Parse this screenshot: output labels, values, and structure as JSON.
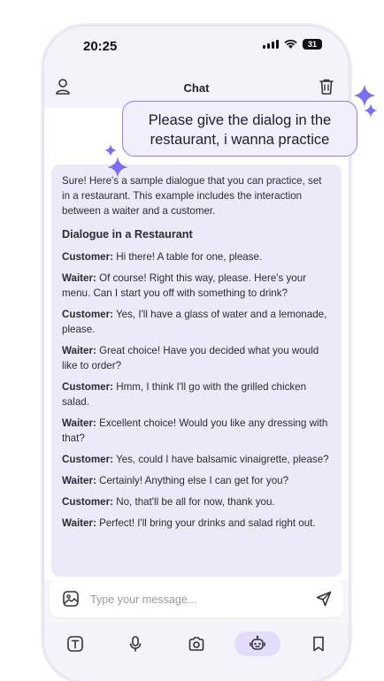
{
  "status_bar": {
    "time": "20:25",
    "battery": "31"
  },
  "header": {
    "title": "Chat"
  },
  "user_message": "Please give the dialog in the restaurant, i wanna practice",
  "assistant_message": {
    "intro": "Sure! Here's a sample dialogue that you can practice, set in a restaurant. This example includes the interaction between a waiter and a customer.",
    "heading": "Dialogue in a Restaurant",
    "lines": [
      {
        "speaker": "Customer:",
        "text": " Hi there! A table for one, please."
      },
      {
        "speaker": "Waiter:",
        "text": " Of course! Right this way, please. Here's your menu. Can I start you off with something to drink?"
      },
      {
        "speaker": "Customer:",
        "text": " Yes, I'll have a glass of water and a lemonade, please."
      },
      {
        "speaker": "Waiter:",
        "text": " Great choice! Have you decided what you would like to order?"
      },
      {
        "speaker": "Customer:",
        "text": " Hmm, I think I'll go with the grilled chicken salad."
      },
      {
        "speaker": "Waiter:",
        "text": " Excellent choice! Would you like any dressing with that?"
      },
      {
        "speaker": "Customer:",
        "text": " Yes, could I have balsamic vinaigrette, please?"
      },
      {
        "speaker": "Waiter:",
        "text": " Certainly! Anything else I can get for you?"
      },
      {
        "speaker": "Customer:",
        "text": " No, that'll be all for now, thank you."
      },
      {
        "speaker": "Waiter:",
        "text": " Perfect! I'll bring your drinks and salad right out."
      }
    ]
  },
  "input": {
    "placeholder": "Type your message..."
  },
  "tabs": [
    "text-icon",
    "microphone-icon",
    "camera-icon",
    "robot-icon",
    "bookmark-icon"
  ],
  "colors": {
    "accent": "#7b6ef0",
    "card": "#eceaf6",
    "active_tab": "#e3dcfb"
  }
}
